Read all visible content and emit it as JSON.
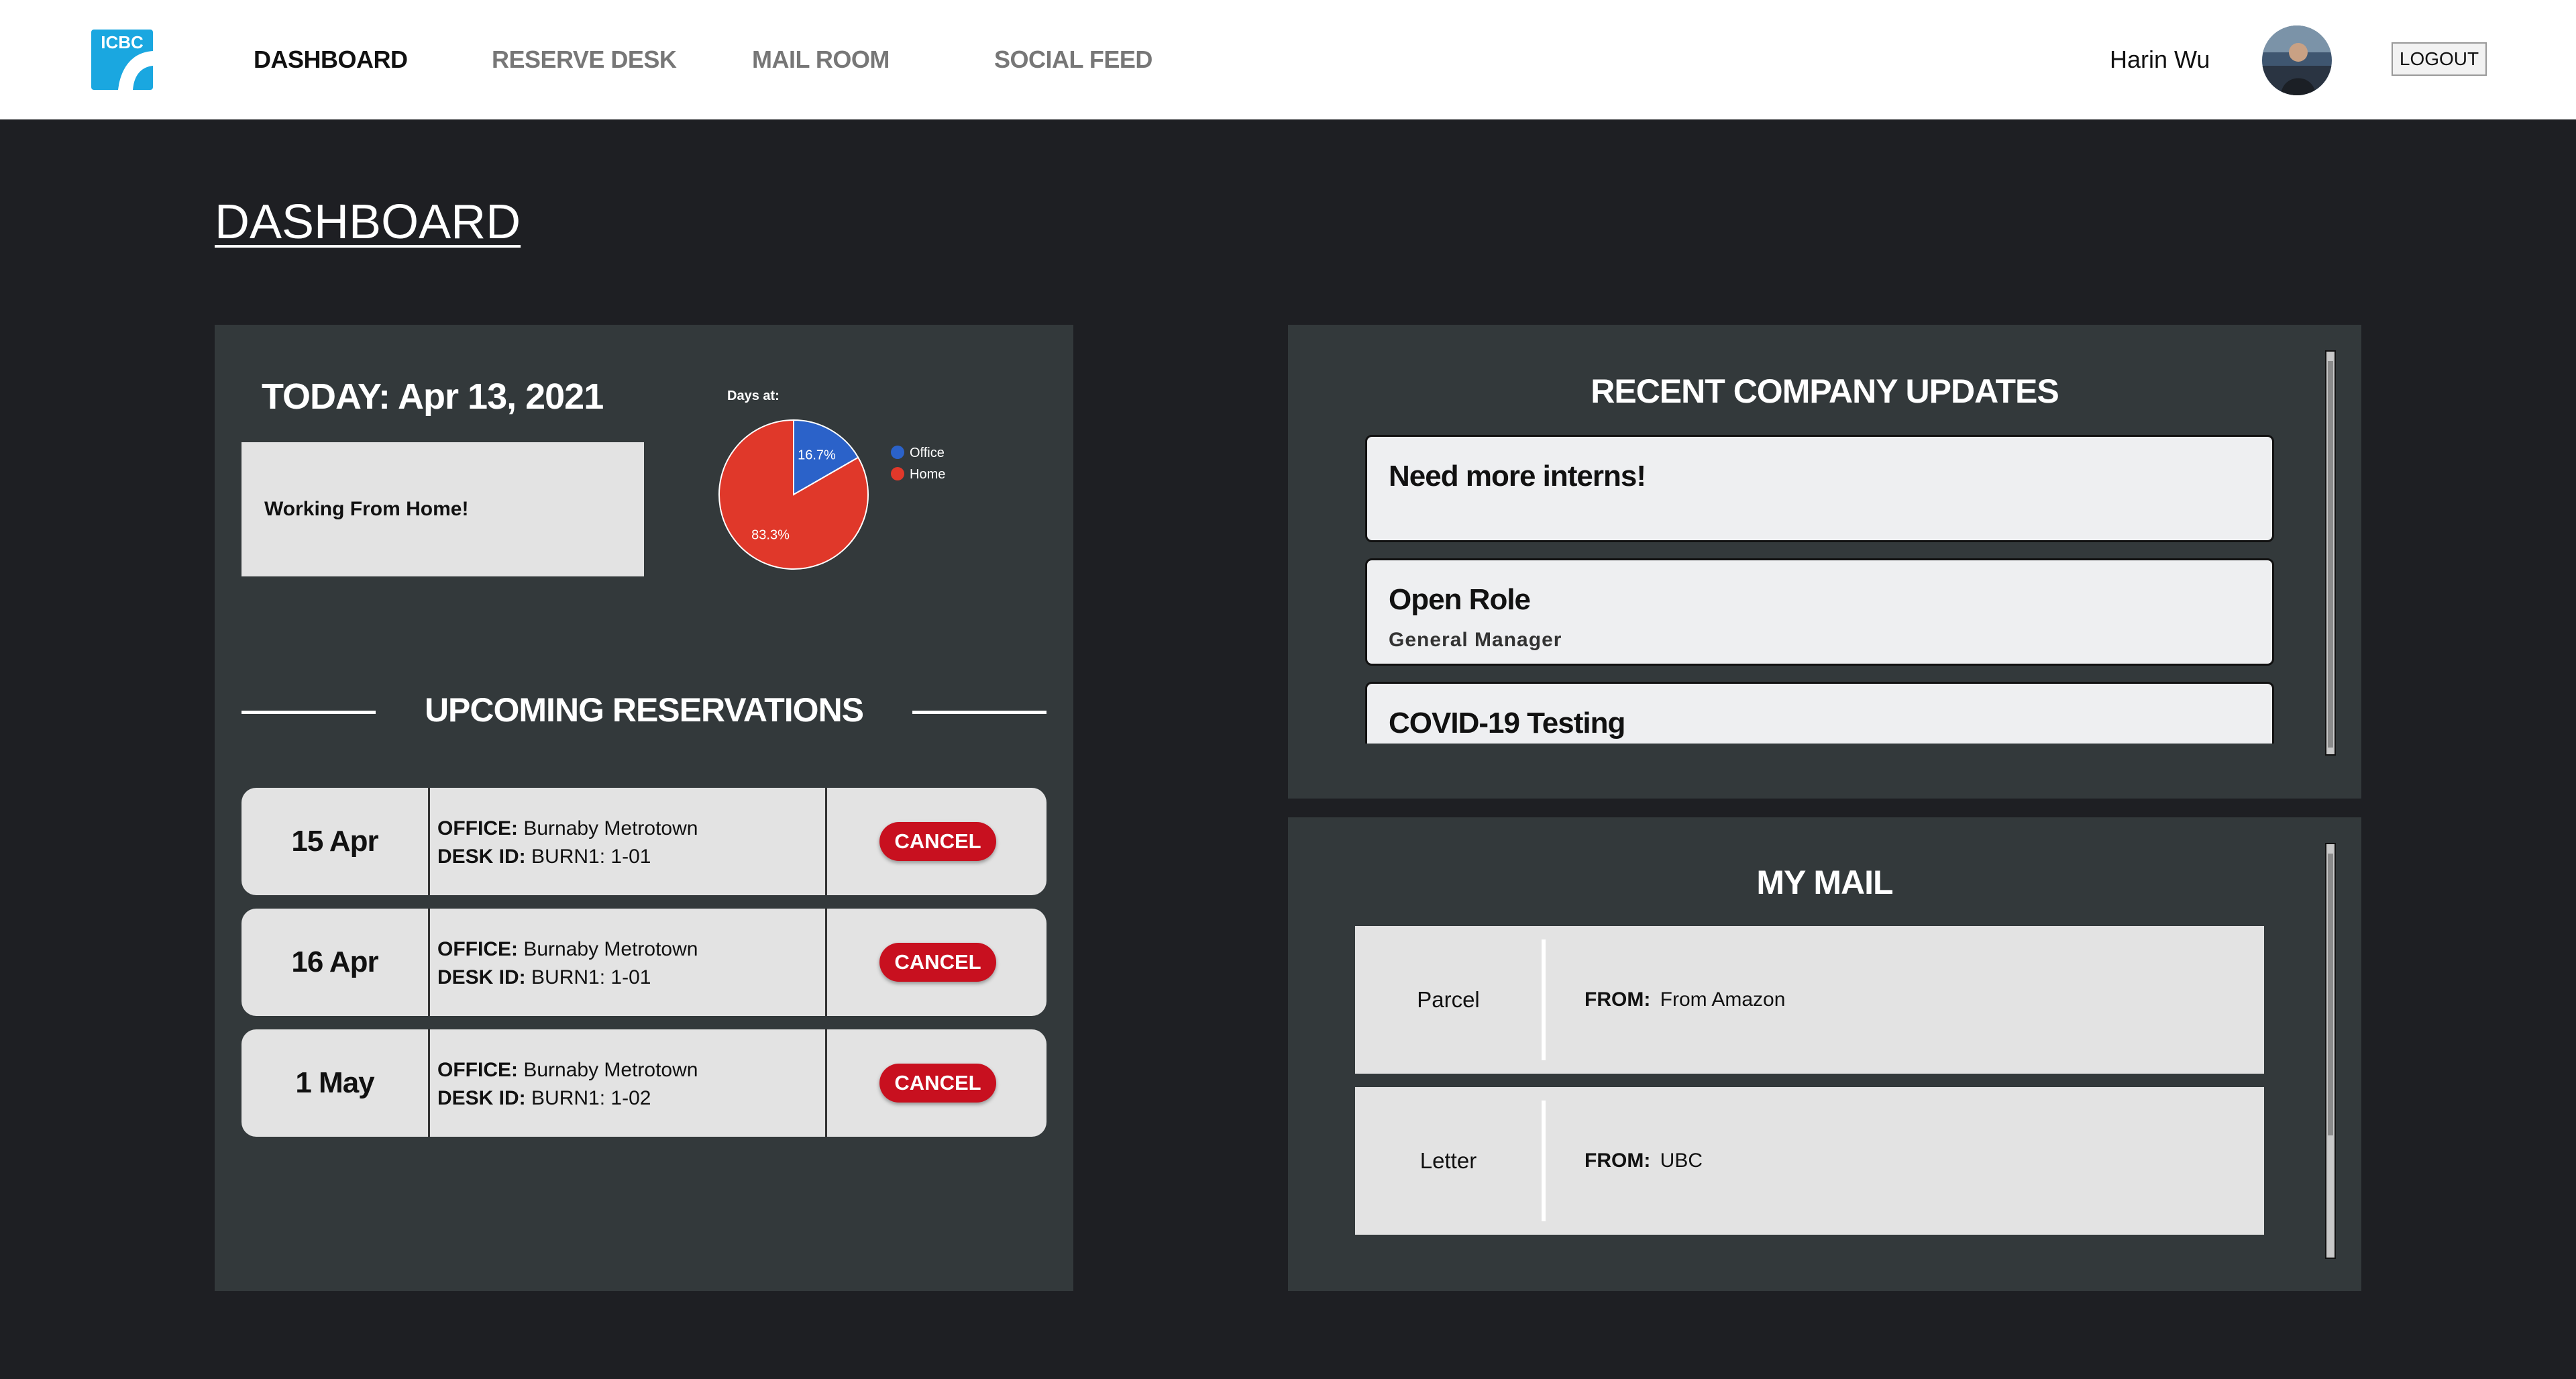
{
  "header": {
    "logo_text": "ICBC",
    "nav": [
      {
        "label": "DASHBOARD",
        "active": true
      },
      {
        "label": "RESERVE DESK",
        "active": false
      },
      {
        "label": "MAIL ROOM",
        "active": false
      },
      {
        "label": "SOCIAL FEED",
        "active": false
      }
    ],
    "user_name": "Harin Wu",
    "logout_label": "LOGOUT"
  },
  "page": {
    "title": "DASHBOARD"
  },
  "today": {
    "label": "TODAY: Apr 13, 2021",
    "status": "Working From Home!"
  },
  "chart_data": {
    "type": "pie",
    "title": "Days at:",
    "categories": [
      "Office",
      "Home"
    ],
    "values": [
      16.7,
      83.3
    ],
    "labels": [
      "16.7%",
      "83.3%"
    ],
    "colors": [
      "#2b62c9",
      "#e0382a"
    ],
    "legend": "top-right"
  },
  "reservations": {
    "heading": "UPCOMING RESERVATIONS",
    "office_label": "OFFICE:",
    "desk_label": "DESK ID:",
    "cancel_label": "CANCEL",
    "items": [
      {
        "date": "15 Apr",
        "office": "Burnaby Metrotown",
        "desk": "BURN1: 1-01"
      },
      {
        "date": "16 Apr",
        "office": "Burnaby Metrotown",
        "desk": "BURN1: 1-01"
      },
      {
        "date": "1 May",
        "office": "Burnaby Metrotown",
        "desk": "BURN1: 1-02"
      }
    ]
  },
  "updates": {
    "heading": "RECENT COMPANY UPDATES",
    "items": [
      {
        "title": "Need more interns!",
        "subtitle": ""
      },
      {
        "title": "Open Role",
        "subtitle": "General Manager"
      },
      {
        "title": "COVID-19 Testing",
        "subtitle": ""
      }
    ]
  },
  "mail": {
    "heading": "MY MAIL",
    "from_label": "FROM:",
    "items": [
      {
        "type": "Parcel",
        "from": "From Amazon"
      },
      {
        "type": "Letter",
        "from": "UBC"
      }
    ]
  },
  "colors": {
    "background": "#1e1f23",
    "panel": "#33393b",
    "accent_red": "#c8101f",
    "logo_blue": "#1aa7e0"
  }
}
